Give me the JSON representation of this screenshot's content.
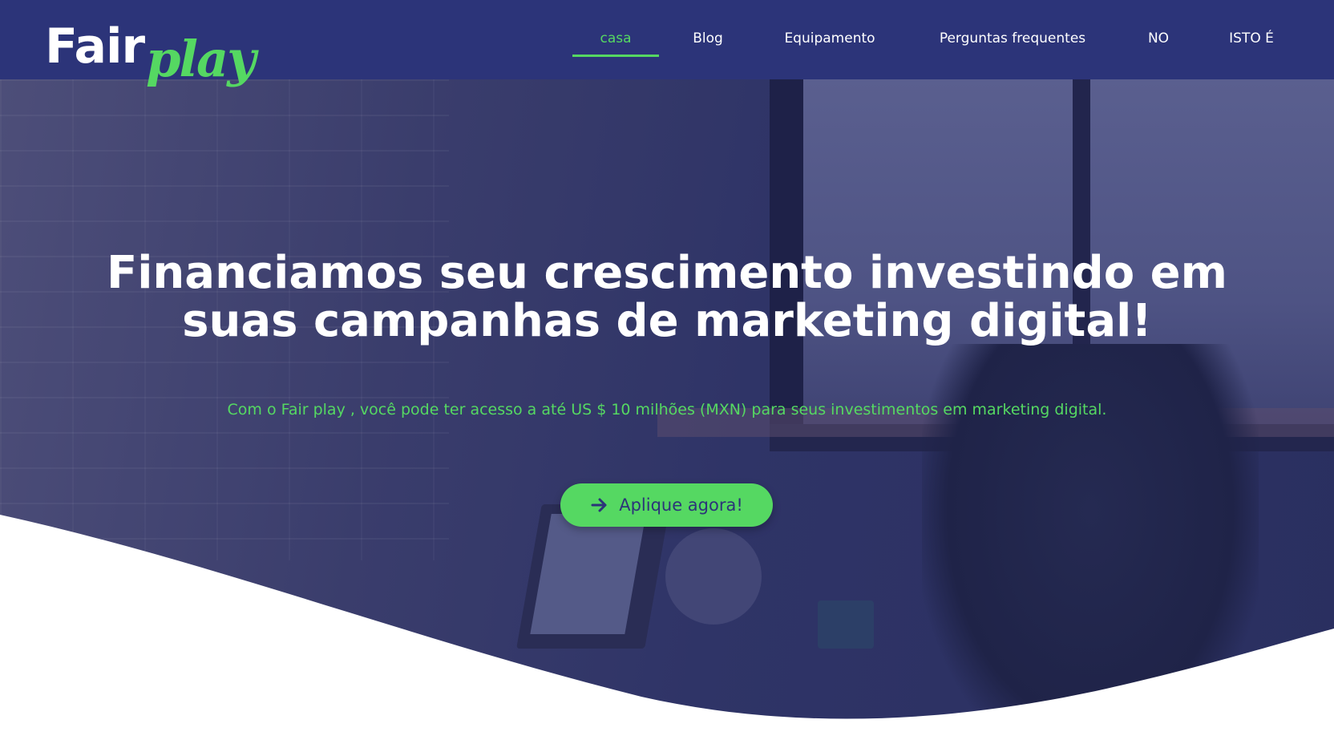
{
  "header": {
    "logo": {
      "part1": "Fair",
      "part2": "play"
    },
    "nav": [
      {
        "label": "casa",
        "active": true
      },
      {
        "label": "Blog",
        "active": false
      },
      {
        "label": "Equipamento",
        "active": false
      },
      {
        "label": "Perguntas frequentes",
        "active": false
      },
      {
        "label": "NO",
        "active": false
      },
      {
        "label": "ISTO É",
        "active": false
      }
    ]
  },
  "hero": {
    "headline_line1": "Financiamos seu crescimento investindo em",
    "headline_line2": "suas campanhas de marketing digital!",
    "subtitle": "Com o  Fair play , você pode ter acesso a até US $ 10 milhões (MXN) para seus investimentos em marketing digital.",
    "cta_label": "Aplique agora!",
    "cta_icon": "arrow-right-icon"
  },
  "colors": {
    "header_bg": "#2c3479",
    "accent_green": "#55d862",
    "text_white": "#ffffff"
  }
}
